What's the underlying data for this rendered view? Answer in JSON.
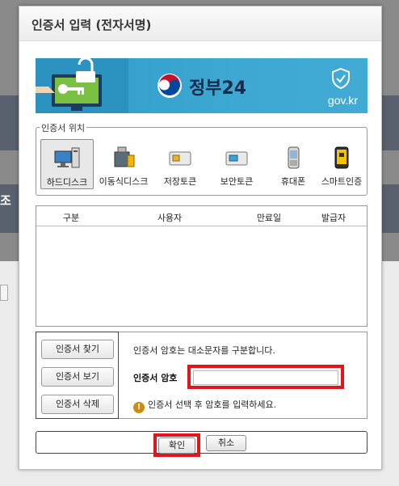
{
  "background": {
    "fragment_text": "조"
  },
  "dialog": {
    "title": "인증서 입력 (전자서명)"
  },
  "banner": {
    "brand": "정부24",
    "domain": "gov.kr"
  },
  "location": {
    "legend": "인증서 위치",
    "items": [
      {
        "label": "하드디스크",
        "icon": "pc-icon",
        "selected": true
      },
      {
        "label": "이동식디스크",
        "icon": "usb-drive-icon",
        "selected": false
      },
      {
        "label": "저장토큰",
        "icon": "storage-token-icon",
        "selected": false
      },
      {
        "label": "보안토큰",
        "icon": "security-token-icon",
        "selected": false
      },
      {
        "label": "휴대폰",
        "icon": "mobile-phone-icon",
        "selected": false
      },
      {
        "label": "스마트인증",
        "icon": "smart-auth-icon",
        "selected": false
      }
    ]
  },
  "table": {
    "columns": [
      "구분",
      "사용자",
      "만료일",
      "발급자"
    ],
    "rows": []
  },
  "actions": {
    "find": "인증서 찾기",
    "view": "인증서 보기",
    "delete": "인증서 삭제"
  },
  "password": {
    "note": "인증서 암호는 대소문자를 구분합니다.",
    "label": "인증서 암호",
    "value": "",
    "warning": "인증서 선택 후 암호를 입력하세요."
  },
  "footer": {
    "ok": "확인",
    "cancel": "취소"
  },
  "colors": {
    "highlight": "#e8121b",
    "banner": "#3da8d2",
    "warning_icon": "#c98e12"
  }
}
